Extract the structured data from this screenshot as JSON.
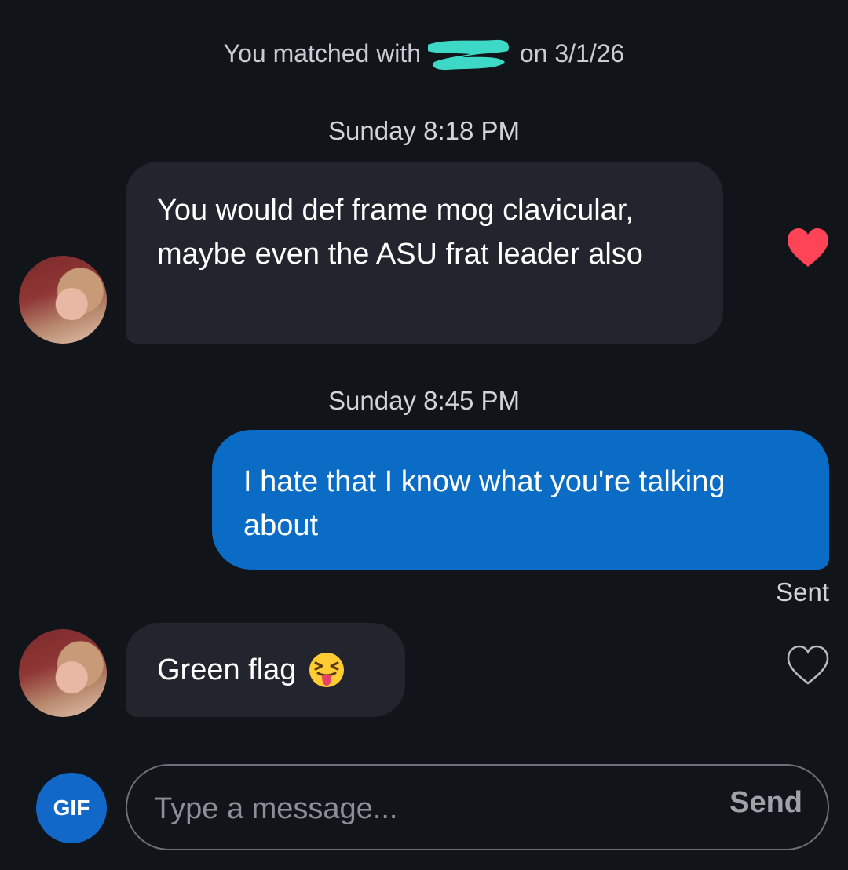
{
  "match_banner": {
    "prefix": "You matched with ",
    "suffix": " on 3/1/26"
  },
  "colors": {
    "background": "#111419",
    "incoming_bubble": "#22252d",
    "outgoing_bubble": "#0a6cc4",
    "liked_heart": "#ff4458",
    "gif_button": "#1268c8"
  },
  "messages": [
    {
      "timestamp": "Sunday 8:18 PM",
      "direction": "incoming",
      "text": "You would def frame mog clavicular, maybe even the ASU frat leader also",
      "liked": true,
      "heart_icon": "heart-filled-icon"
    },
    {
      "timestamp": "Sunday 8:45 PM",
      "direction": "outgoing",
      "text": "I hate that I know what you're talking about",
      "status": "Sent"
    },
    {
      "direction": "incoming",
      "text": "Green flag",
      "emoji": "squinting-face-with-tongue-icon",
      "liked": false,
      "heart_icon": "heart-outline-icon"
    }
  ],
  "composer": {
    "gif_label": "GIF",
    "placeholder": "Type a message...",
    "send_label": "Send"
  }
}
